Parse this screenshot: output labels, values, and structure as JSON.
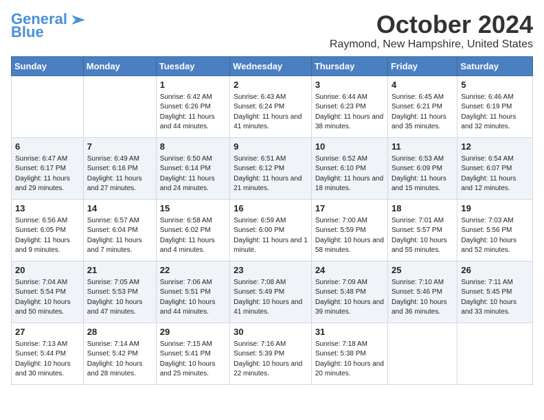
{
  "header": {
    "logo_general": "General",
    "logo_blue": "Blue",
    "month_title": "October 2024",
    "location": "Raymond, New Hampshire, United States"
  },
  "weekdays": [
    "Sunday",
    "Monday",
    "Tuesday",
    "Wednesday",
    "Thursday",
    "Friday",
    "Saturday"
  ],
  "weeks": [
    [
      {
        "day": "",
        "sunrise": "",
        "sunset": "",
        "daylight": ""
      },
      {
        "day": "",
        "sunrise": "",
        "sunset": "",
        "daylight": ""
      },
      {
        "day": "1",
        "sunrise": "Sunrise: 6:42 AM",
        "sunset": "Sunset: 6:26 PM",
        "daylight": "Daylight: 11 hours and 44 minutes."
      },
      {
        "day": "2",
        "sunrise": "Sunrise: 6:43 AM",
        "sunset": "Sunset: 6:24 PM",
        "daylight": "Daylight: 11 hours and 41 minutes."
      },
      {
        "day": "3",
        "sunrise": "Sunrise: 6:44 AM",
        "sunset": "Sunset: 6:23 PM",
        "daylight": "Daylight: 11 hours and 38 minutes."
      },
      {
        "day": "4",
        "sunrise": "Sunrise: 6:45 AM",
        "sunset": "Sunset: 6:21 PM",
        "daylight": "Daylight: 11 hours and 35 minutes."
      },
      {
        "day": "5",
        "sunrise": "Sunrise: 6:46 AM",
        "sunset": "Sunset: 6:19 PM",
        "daylight": "Daylight: 11 hours and 32 minutes."
      }
    ],
    [
      {
        "day": "6",
        "sunrise": "Sunrise: 6:47 AM",
        "sunset": "Sunset: 6:17 PM",
        "daylight": "Daylight: 11 hours and 29 minutes."
      },
      {
        "day": "7",
        "sunrise": "Sunrise: 6:49 AM",
        "sunset": "Sunset: 6:16 PM",
        "daylight": "Daylight: 11 hours and 27 minutes."
      },
      {
        "day": "8",
        "sunrise": "Sunrise: 6:50 AM",
        "sunset": "Sunset: 6:14 PM",
        "daylight": "Daylight: 11 hours and 24 minutes."
      },
      {
        "day": "9",
        "sunrise": "Sunrise: 6:51 AM",
        "sunset": "Sunset: 6:12 PM",
        "daylight": "Daylight: 11 hours and 21 minutes."
      },
      {
        "day": "10",
        "sunrise": "Sunrise: 6:52 AM",
        "sunset": "Sunset: 6:10 PM",
        "daylight": "Daylight: 11 hours and 18 minutes."
      },
      {
        "day": "11",
        "sunrise": "Sunrise: 6:53 AM",
        "sunset": "Sunset: 6:09 PM",
        "daylight": "Daylight: 11 hours and 15 minutes."
      },
      {
        "day": "12",
        "sunrise": "Sunrise: 6:54 AM",
        "sunset": "Sunset: 6:07 PM",
        "daylight": "Daylight: 11 hours and 12 minutes."
      }
    ],
    [
      {
        "day": "13",
        "sunrise": "Sunrise: 6:56 AM",
        "sunset": "Sunset: 6:05 PM",
        "daylight": "Daylight: 11 hours and 9 minutes."
      },
      {
        "day": "14",
        "sunrise": "Sunrise: 6:57 AM",
        "sunset": "Sunset: 6:04 PM",
        "daylight": "Daylight: 11 hours and 7 minutes."
      },
      {
        "day": "15",
        "sunrise": "Sunrise: 6:58 AM",
        "sunset": "Sunset: 6:02 PM",
        "daylight": "Daylight: 11 hours and 4 minutes."
      },
      {
        "day": "16",
        "sunrise": "Sunrise: 6:59 AM",
        "sunset": "Sunset: 6:00 PM",
        "daylight": "Daylight: 11 hours and 1 minute."
      },
      {
        "day": "17",
        "sunrise": "Sunrise: 7:00 AM",
        "sunset": "Sunset: 5:59 PM",
        "daylight": "Daylight: 10 hours and 58 minutes."
      },
      {
        "day": "18",
        "sunrise": "Sunrise: 7:01 AM",
        "sunset": "Sunset: 5:57 PM",
        "daylight": "Daylight: 10 hours and 55 minutes."
      },
      {
        "day": "19",
        "sunrise": "Sunrise: 7:03 AM",
        "sunset": "Sunset: 5:56 PM",
        "daylight": "Daylight: 10 hours and 52 minutes."
      }
    ],
    [
      {
        "day": "20",
        "sunrise": "Sunrise: 7:04 AM",
        "sunset": "Sunset: 5:54 PM",
        "daylight": "Daylight: 10 hours and 50 minutes."
      },
      {
        "day": "21",
        "sunrise": "Sunrise: 7:05 AM",
        "sunset": "Sunset: 5:53 PM",
        "daylight": "Daylight: 10 hours and 47 minutes."
      },
      {
        "day": "22",
        "sunrise": "Sunrise: 7:06 AM",
        "sunset": "Sunset: 5:51 PM",
        "daylight": "Daylight: 10 hours and 44 minutes."
      },
      {
        "day": "23",
        "sunrise": "Sunrise: 7:08 AM",
        "sunset": "Sunset: 5:49 PM",
        "daylight": "Daylight: 10 hours and 41 minutes."
      },
      {
        "day": "24",
        "sunrise": "Sunrise: 7:09 AM",
        "sunset": "Sunset: 5:48 PM",
        "daylight": "Daylight: 10 hours and 39 minutes."
      },
      {
        "day": "25",
        "sunrise": "Sunrise: 7:10 AM",
        "sunset": "Sunset: 5:46 PM",
        "daylight": "Daylight: 10 hours and 36 minutes."
      },
      {
        "day": "26",
        "sunrise": "Sunrise: 7:11 AM",
        "sunset": "Sunset: 5:45 PM",
        "daylight": "Daylight: 10 hours and 33 minutes."
      }
    ],
    [
      {
        "day": "27",
        "sunrise": "Sunrise: 7:13 AM",
        "sunset": "Sunset: 5:44 PM",
        "daylight": "Daylight: 10 hours and 30 minutes."
      },
      {
        "day": "28",
        "sunrise": "Sunrise: 7:14 AM",
        "sunset": "Sunset: 5:42 PM",
        "daylight": "Daylight: 10 hours and 28 minutes."
      },
      {
        "day": "29",
        "sunrise": "Sunrise: 7:15 AM",
        "sunset": "Sunset: 5:41 PM",
        "daylight": "Daylight: 10 hours and 25 minutes."
      },
      {
        "day": "30",
        "sunrise": "Sunrise: 7:16 AM",
        "sunset": "Sunset: 5:39 PM",
        "daylight": "Daylight: 10 hours and 22 minutes."
      },
      {
        "day": "31",
        "sunrise": "Sunrise: 7:18 AM",
        "sunset": "Sunset: 5:38 PM",
        "daylight": "Daylight: 10 hours and 20 minutes."
      },
      {
        "day": "",
        "sunrise": "",
        "sunset": "",
        "daylight": ""
      },
      {
        "day": "",
        "sunrise": "",
        "sunset": "",
        "daylight": ""
      }
    ]
  ]
}
